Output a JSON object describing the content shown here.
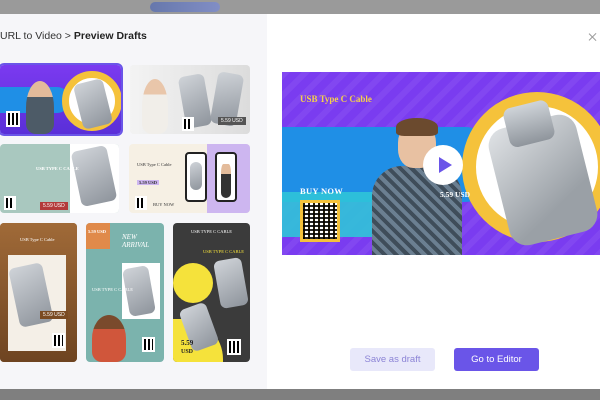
{
  "breadcrumb": {
    "parent": "URL to Video",
    "separator": ">",
    "current": "Preview Drafts"
  },
  "drafts": [
    {
      "name": "draft-1",
      "selected": true
    },
    {
      "name": "draft-2",
      "selected": false
    },
    {
      "name": "draft-3",
      "selected": false
    },
    {
      "name": "draft-4",
      "selected": false
    },
    {
      "name": "draft-5",
      "selected": false
    },
    {
      "name": "draft-6",
      "selected": false
    },
    {
      "name": "draft-7",
      "selected": false
    }
  ],
  "preview": {
    "title": "USB Type C Cable",
    "cta": "BUY NOW",
    "price": "5.59 USD"
  },
  "thumbs": {
    "t2_price": "5.59 USD",
    "t3_title": "USB TYPE C CABLE",
    "t3_price": "5.59 USD",
    "t4_title": "USB Type C Cable",
    "t4_price": "5.59 USD",
    "t4_cta": "BUY NOW",
    "t5_title": "USB Type C Cable",
    "t5_price": "5.59 USD",
    "t6_price": "5.59 USD",
    "t6_tag": "NEW ARRIVAL",
    "t6_title": "USB TYPE C CABLE",
    "t7_title": "USB TYPE C CABLE",
    "t7_top": "USB TYPE C CABLE",
    "t7_price": "5.59",
    "t7_unit": "USD"
  },
  "buttons": {
    "save_draft": "Save as draft",
    "go_editor": "Go to Editor"
  },
  "colors": {
    "accent": "#6a55e8",
    "preview_bg": "#7a3cf0",
    "highlight": "#f5c23b"
  },
  "icons": {
    "play": "play-icon",
    "close": "close-icon"
  }
}
